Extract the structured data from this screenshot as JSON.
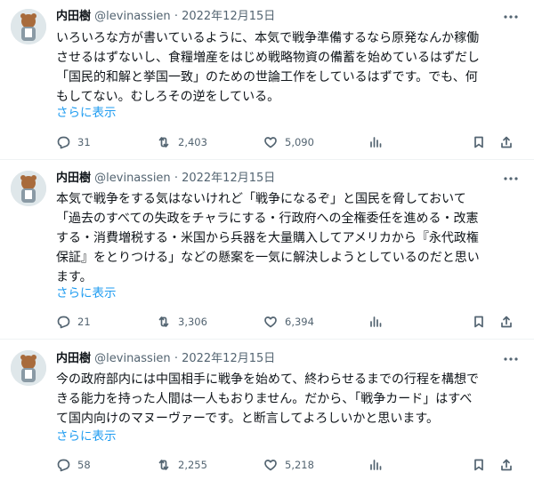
{
  "tweets": [
    {
      "name": "内田樹",
      "handle": "@levinassien",
      "sep": "·",
      "date": "2022年12月15日",
      "more": "…",
      "lines": [
        "いろいろな方が書いているように、本気で戦争準備するなら原発なんか稼働",
        "させるはずないし、食糧増産をはじめ戦略物資の備蓄を始めているはずだし",
        "「国民的和解と挙国一致」のための世論工作をしているはずです。でも、何",
        "もしてない。むしろその逆をしている。"
      ],
      "show_more": "さらに表示",
      "replies": "31",
      "retweets": "2,403",
      "likes": "5,090"
    },
    {
      "name": "内田樹",
      "handle": "@levinassien",
      "sep": "·",
      "date": "2022年12月15日",
      "more": "…",
      "lines": [
        "本気で戦争をする気はないけれど「戦争になるぞ」と国民を脅しておいて",
        "「過去のすべての失政をチャラにする・行政府への全権委任を進める・改憲",
        "する・消費増税する・米国から兵器を大量購入してアメリカから『永代政権",
        "保証』をとりつける」などの懸案を一気に解決しようとしているのだと思い",
        "ます。"
      ],
      "show_more": "さらに表示",
      "replies": "21",
      "retweets": "3,306",
      "likes": "6,394"
    },
    {
      "name": "内田樹",
      "handle": "@levinassien",
      "sep": "·",
      "date": "2022年12月15日",
      "more": "…",
      "lines": [
        "今の政府部内には中国相手に戦争を始めて、終わらせるまでの行程を構想で",
        "きる能力を持った人間は一人もおりません。だから、「戦争カード」はすべ",
        "て国内向けのマヌーヴァーです。と断言してよろしいかと思います。"
      ],
      "show_more": "さらに表示",
      "replies": "58",
      "retweets": "2,255",
      "likes": "5,218"
    }
  ],
  "icons": {
    "reply": "reply-icon",
    "retweet": "retweet-icon",
    "like": "like-icon",
    "views": "views-icon",
    "bookmark": "bookmark-icon",
    "share": "share-icon",
    "more": "more-icon"
  },
  "colors": {
    "link": "#1d9bf0",
    "secondary": "#536471",
    "text": "#0f1419"
  }
}
